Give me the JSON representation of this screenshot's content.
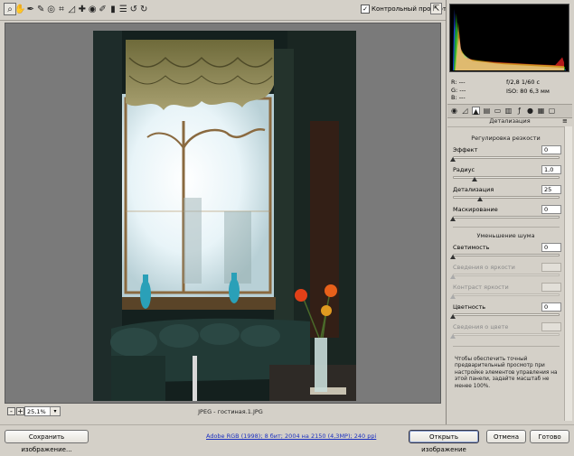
{
  "toolbar": {
    "tools": [
      {
        "name": "zoom-tool-icon",
        "glyph": "⌕",
        "selected": true
      },
      {
        "name": "hand-tool-icon",
        "glyph": "✋"
      },
      {
        "name": "white-balance-tool-icon",
        "glyph": "✒"
      },
      {
        "name": "color-sampler-tool-icon",
        "glyph": "✎"
      },
      {
        "name": "target-adjustment-tool-icon",
        "glyph": "◎"
      },
      {
        "name": "crop-tool-icon",
        "glyph": "⌗"
      },
      {
        "name": "straighten-tool-icon",
        "glyph": "◿"
      },
      {
        "name": "spot-removal-tool-icon",
        "glyph": "✚"
      },
      {
        "name": "red-eye-tool-icon",
        "glyph": "◉"
      },
      {
        "name": "adjustment-brush-icon",
        "glyph": "✐"
      },
      {
        "name": "graduated-filter-icon",
        "glyph": "▮"
      },
      {
        "name": "preferences-icon",
        "glyph": "☰"
      },
      {
        "name": "rotate-left-icon",
        "glyph": "↺"
      },
      {
        "name": "rotate-right-icon",
        "glyph": "↻"
      }
    ],
    "preview_label": "Контрольный просмотр",
    "preview_checked": "✓",
    "fullscreen_glyph": "⇱"
  },
  "status": {
    "zoom_minus": "-",
    "zoom_plus": "+",
    "zoom_value": "25,1%",
    "zoom_dropdown": "▾",
    "filename": "JPEG - гостиная.1.JPG"
  },
  "info": {
    "r": "R:  ---",
    "g": "G:  ---",
    "b": "B:  ---",
    "aperture_shutter": "f/2,8   1/60 с",
    "iso_focal": "ISO: 80   6,3 мм"
  },
  "panel": {
    "section_title": "Детализация",
    "section_menu": "≡",
    "sharpening": {
      "title": "Регулировка резкости",
      "sliders": [
        {
          "label": "Эффект",
          "value": "0",
          "level": 0
        },
        {
          "label": "Радиус",
          "value": "1,0",
          "level": 0.2
        },
        {
          "label": "Детализация",
          "value": "25",
          "level": 0.25
        },
        {
          "label": "Маскирование",
          "value": "0",
          "level": 0
        }
      ]
    },
    "noise": {
      "title": "Уменьшение шума",
      "sliders": [
        {
          "label": "Светимость",
          "value": "0",
          "level": 0,
          "disabled": false
        },
        {
          "label": "Сведения о яркости",
          "value": "",
          "level": 0,
          "disabled": true
        },
        {
          "label": "Контраст яркости",
          "value": "",
          "level": 0,
          "disabled": true
        },
        {
          "label": "Цветность",
          "value": "0",
          "level": 0,
          "disabled": false
        },
        {
          "label": "Сведения о цвете",
          "value": "",
          "level": 0,
          "disabled": true
        }
      ]
    },
    "note": "Чтобы обеспечить точный предварительный просмотр при настройке элементов управления на этой панели, задайте масштаб не менее 100%."
  },
  "bottom": {
    "save_label": "Сохранить изображение...",
    "workflow_link": "Adobe RGB (1998); 8 бит; 2004 на 2150 (4,3МР); 240 ppi",
    "open_label": "Открыть изображение",
    "cancel_label": "Отмена",
    "done_label": "Готово"
  },
  "colors": {
    "panel_bg": "#d4d0c8",
    "canvas_bg": "#7a7a7a",
    "link": "#1a2fc0"
  }
}
